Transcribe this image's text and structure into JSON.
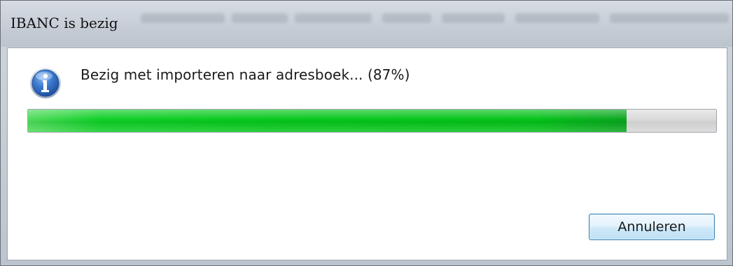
{
  "window": {
    "title": "IBANC is bezig"
  },
  "dialog": {
    "icon": "info-icon",
    "message": "Bezig met importeren naar adresboek... (87%)",
    "progress_fraction": 0.87,
    "cancel_label": "Annuleren"
  },
  "colors": {
    "progress_green": "#06c81c",
    "button_border": "#3c7fb1"
  }
}
